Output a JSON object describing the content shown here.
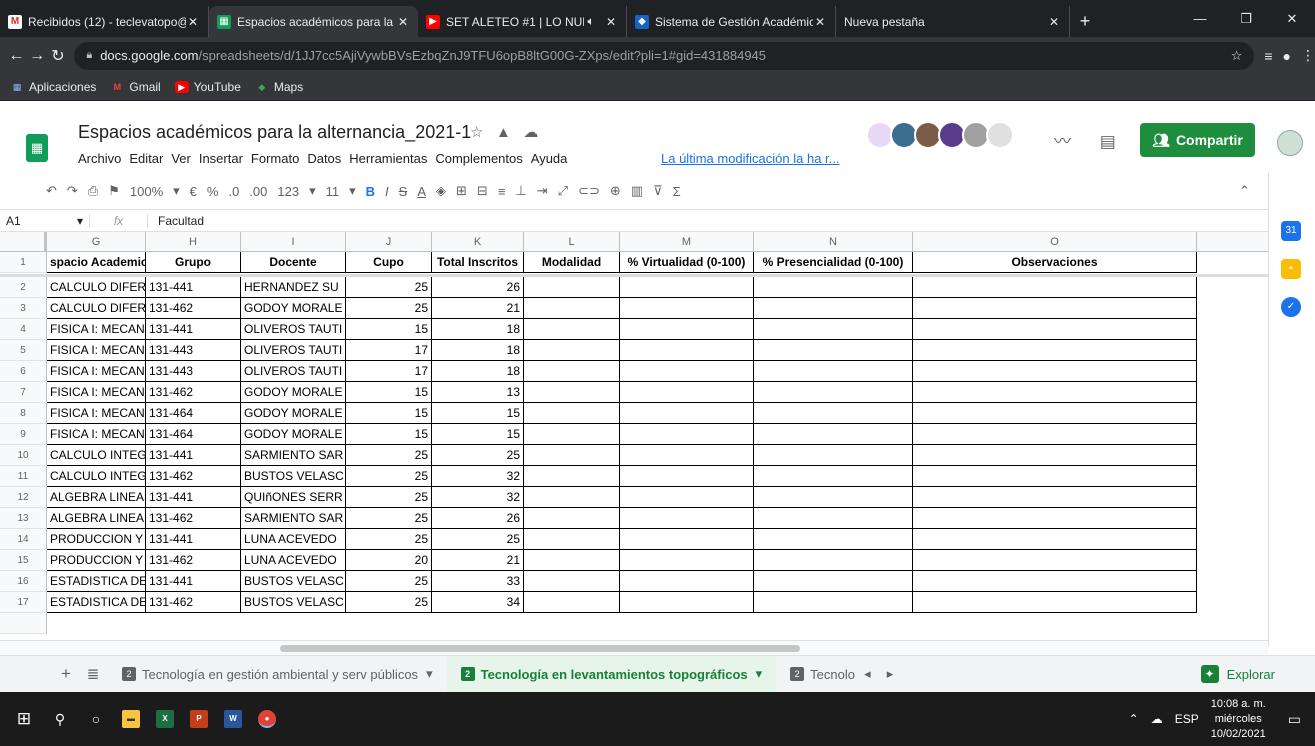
{
  "browser": {
    "tabs": [
      {
        "title": "Recibidos (12) - teclevatopo@",
        "favicon": "gmail-icon",
        "active": false
      },
      {
        "title": "Espacios académicos para la al",
        "favicon": "sheets-icon",
        "active": true
      },
      {
        "title": "SET ALETEO #1 | LO NUEV",
        "favicon": "youtube-icon",
        "active": false
      },
      {
        "title": "Sistema de Gestión Académica",
        "favicon": "sga-icon",
        "active": false
      },
      {
        "title": "Nueva pestaña",
        "favicon": "",
        "active": false
      }
    ],
    "url_host": "docs.google.com",
    "url_path": "/spreadsheets/d/1JJ7cc5AjiVywbBVsEzbqZnJ9TFU6opB8ltG00G-ZXps/edit?pli=1#gid=431884945",
    "bookmarks": [
      "Aplicaciones",
      "Gmail",
      "YouTube",
      "Maps"
    ]
  },
  "doc": {
    "title": "Espacios académicos para la alternancia_2021-1",
    "menu": [
      "Archivo",
      "Editar",
      "Ver",
      "Insertar",
      "Formato",
      "Datos",
      "Herramientas",
      "Complementos",
      "Ayuda"
    ],
    "last_edit": "La última modificación la ha r...",
    "share_label": "Compartir",
    "avatar_colors": [
      "#e8d7f5",
      "#3c6e8f",
      "#7a5c48",
      "#5b3c8c",
      "#a0a0a0",
      "#e0e0e0"
    ]
  },
  "toolbar": {
    "zoom": "100%",
    "currency": "€",
    "percent": "%",
    "dec_less": ".0",
    "dec_more": ".00",
    "format_more": "123",
    "font_size": "11",
    "bold": "B",
    "italic": "I",
    "strike": "S",
    "text_color": "A"
  },
  "formula_bar": {
    "cell_ref": "A1",
    "fx": "fx",
    "value": "Facultad"
  },
  "grid": {
    "columns": [
      "G",
      "H",
      "I",
      "J",
      "K",
      "L",
      "M",
      "N",
      "O"
    ],
    "headers": [
      "spacio Academic",
      "Grupo",
      "Docente",
      "Cupo",
      "Total Inscritos",
      "Modalidad",
      "% Virtualidad (0-100)",
      "% Presencialidad (0-100)",
      "Observaciones"
    ],
    "rows": [
      {
        "n": "2",
        "g": "CALCULO DIFERE",
        "h": "131-441",
        "i": "HERNANDEZ SU",
        "j": "25",
        "k": "26"
      },
      {
        "n": "3",
        "g": "CALCULO DIFERE",
        "h": "131-462",
        "i": "GODOY MORALE",
        "j": "25",
        "k": "21"
      },
      {
        "n": "4",
        "g": "FISICA I: MECAN",
        "h": "131-441",
        "i": "OLIVEROS TAUTI",
        "j": "15",
        "k": "18"
      },
      {
        "n": "5",
        "g": "FISICA I: MECAN",
        "h": "131-443",
        "i": "OLIVEROS TAUTI",
        "j": "17",
        "k": "18"
      },
      {
        "n": "6",
        "g": "FISICA I: MECAN",
        "h": "131-443",
        "i": "OLIVEROS TAUTI",
        "j": "17",
        "k": "18"
      },
      {
        "n": "7",
        "g": "FISICA I: MECAN",
        "h": "131-462",
        "i": "GODOY MORALE",
        "j": "15",
        "k": "13"
      },
      {
        "n": "8",
        "g": "FISICA I: MECAN",
        "h": "131-464",
        "i": "GODOY MORALE",
        "j": "15",
        "k": "15"
      },
      {
        "n": "9",
        "g": "FISICA I: MECAN",
        "h": "131-464",
        "i": "GODOY MORALE",
        "j": "15",
        "k": "15"
      },
      {
        "n": "10",
        "g": "CALCULO INTEGI",
        "h": "131-441",
        "i": "SARMIENTO SAR",
        "j": "25",
        "k": "25"
      },
      {
        "n": "11",
        "g": "CALCULO INTEGI",
        "h": "131-462",
        "i": "BUSTOS VELASC",
        "j": "25",
        "k": "32"
      },
      {
        "n": "12",
        "g": "ALGEBRA LINEAL",
        "h": "131-441",
        "i": "QUIñONES SERR",
        "j": "25",
        "k": "32"
      },
      {
        "n": "13",
        "g": "ALGEBRA LINEAL",
        "h": "131-462",
        "i": "SARMIENTO SAR",
        "j": "25",
        "k": "26"
      },
      {
        "n": "14",
        "g": "PRODUCCION Y",
        "h": "131-441",
        "i": "LUNA ACEVEDO",
        "j": "25",
        "k": "25"
      },
      {
        "n": "15",
        "g": "PRODUCCION Y",
        "h": "131-462",
        "i": "LUNA ACEVEDO",
        "j": "20",
        "k": "21"
      },
      {
        "n": "16",
        "g": "ESTADISTICA DES",
        "h": "131-441",
        "i": "BUSTOS VELASC",
        "j": "25",
        "k": "33"
      },
      {
        "n": "17",
        "g": "ESTADISTICA DES",
        "h": "131-462",
        "i": "BUSTOS VELASC",
        "j": "25",
        "k": "34"
      }
    ]
  },
  "sheet_tabs": [
    {
      "num": "2",
      "label": "Tecnología en gestión ambiental y serv públicos",
      "active": false
    },
    {
      "num": "2",
      "label": "Tecnología en levantamientos topográficos",
      "active": true
    },
    {
      "num": "2",
      "label": "Tecnolo",
      "active": false
    }
  ],
  "explore_label": "Explorar",
  "taskbar": {
    "lang": "ESP",
    "time": "10:08 a. m.",
    "day": "miércoles",
    "date": "10/02/2021"
  }
}
